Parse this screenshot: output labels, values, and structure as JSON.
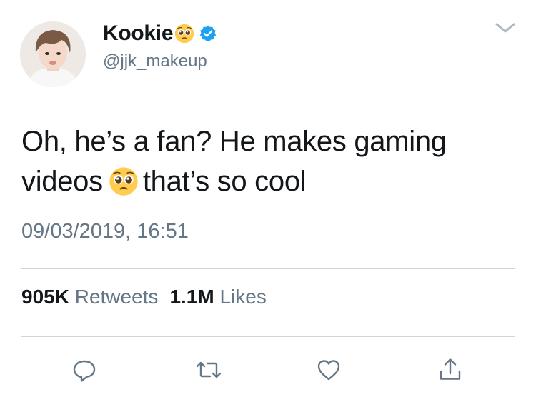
{
  "user": {
    "display_name": "Kookie",
    "name_emoji": "pleading-face-emoji",
    "verified": true,
    "verified_icon": "verified-badge-icon",
    "handle": "@jjk_makeup",
    "avatar": "profile-photo"
  },
  "tweet": {
    "text_part1": "Oh, he’s a fan? He makes gaming videos",
    "text_emoji": "pleading-face-emoji",
    "text_part2": "that’s so cool",
    "timestamp": "09/03/2019, 16:51"
  },
  "stats": {
    "retweets_count": "905K",
    "retweets_label": "Retweets",
    "likes_count": "1.1M",
    "likes_label": "Likes"
  },
  "actions": [
    {
      "name": "reply",
      "icon": "reply-icon"
    },
    {
      "name": "retweet",
      "icon": "retweet-icon"
    },
    {
      "name": "like",
      "icon": "heart-icon"
    },
    {
      "name": "share",
      "icon": "share-icon"
    }
  ],
  "colors": {
    "text": "#14171a",
    "secondary": "#657786",
    "divider": "#ccd6dd",
    "verified": "#1da1f2"
  }
}
